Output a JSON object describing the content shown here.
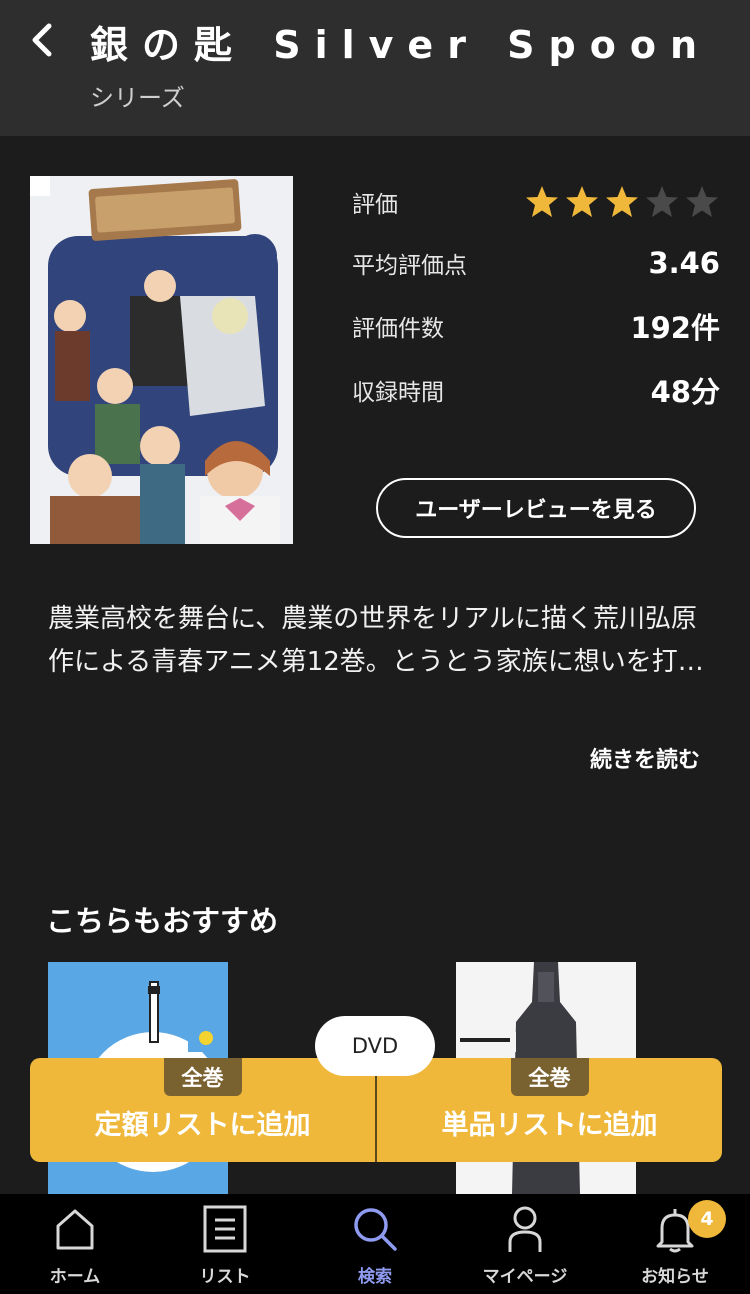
{
  "header": {
    "title": "銀の匙 Silver Spoon",
    "subtitle": "シリーズ"
  },
  "info": {
    "rating_label": "評価",
    "rating_stars": 3,
    "rating_max": 5,
    "avg_label": "平均評価点",
    "avg_value": "3.46",
    "count_label": "評価件数",
    "count_value": "192件",
    "duration_label": "収録時間",
    "duration_value": "48分",
    "star_color_on": "#f0b83a",
    "star_color_off": "#4a4a4a"
  },
  "review_button": "ユーザーレビューを見る",
  "description": "農業高校を舞台に、農業の世界をリアルに描く荒川弘原作による青春アニメ第12巻。とうとう家族に想いを打…",
  "read_more": "続きを読む",
  "recommend": {
    "title": "こちらもおすすめ"
  },
  "format_pill": "DVD",
  "add_bar": {
    "left": {
      "badge": "全巻",
      "label": "定額リストに追加"
    },
    "right": {
      "badge": "全巻",
      "label": "単品リストに追加"
    }
  },
  "nav": {
    "items": [
      {
        "label": "ホーム",
        "icon": "home-icon"
      },
      {
        "label": "リスト",
        "icon": "list-icon"
      },
      {
        "label": "検索",
        "icon": "search-icon"
      },
      {
        "label": "マイページ",
        "icon": "user-icon"
      },
      {
        "label": "お知らせ",
        "icon": "bell-icon"
      }
    ],
    "active": "検索",
    "notification_count": "4"
  }
}
